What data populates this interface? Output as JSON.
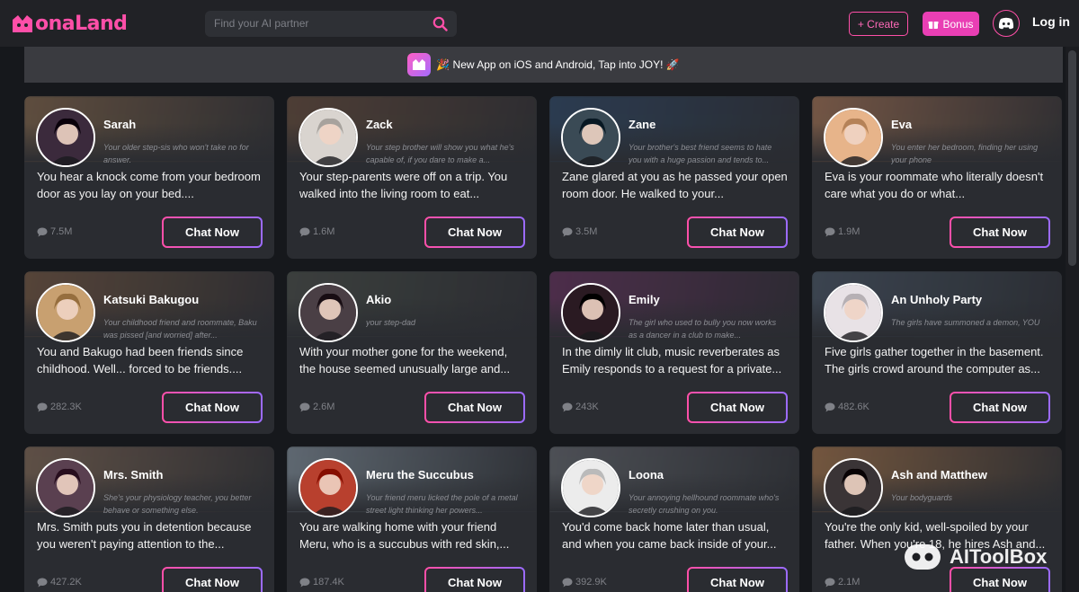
{
  "brand": {
    "logo_text": "onaLand",
    "colors": {
      "accent": "#ff4fa8",
      "accent2": "#9b6bff",
      "bg": "#16181c",
      "card": "#2a2c31"
    }
  },
  "search": {
    "placeholder": "Find your AI partner"
  },
  "header": {
    "create_label": "+ Create",
    "bonus_label": "Bonus",
    "login_label": "Log in"
  },
  "banner": {
    "text": "🎉 New App on iOS and Android, Tap into JOY! 🚀"
  },
  "chat_label": "Chat Now",
  "cards": [
    {
      "name": "Sarah",
      "tagline": "Your older step-sis who won't take no for answer.",
      "desc": "You hear a knock come from your bedroom door as you lay on your bed....",
      "count": "7.5M",
      "bg": "#8a6a4a",
      "av": "#3b2a3c"
    },
    {
      "name": "Zack",
      "tagline": "Your step brother will show you what he's capable of, if you dare to make a...",
      "desc": "Your step-parents were off on a trip. You walked into the living room to eat...",
      "count": "1.6M",
      "bg": "#6b4e3a",
      "av": "#d9d4cf"
    },
    {
      "name": "Zane",
      "tagline": "Your brother's best friend seems to hate you with a huge passion and tends to...",
      "desc": "Zane glared at you as he passed your open room door. He walked to your...",
      "count": "3.5M",
      "bg": "#2d4a6b",
      "av": "#3a4a55"
    },
    {
      "name": "Eva",
      "tagline": "You enter her bedroom, finding her using your phone",
      "desc": "Eva is your roommate who literally doesn't care what you do or what...",
      "count": "1.9M",
      "bg": "#b07a56",
      "av": "#e7b48a"
    },
    {
      "name": "Katsuki Bakugou",
      "tagline": "Your childhood friend and roommate, Baku was pissed [and worried] after...",
      "desc": "You and Bakugo had been friends since childhood. Well... forced to be friends....",
      "count": "282.3K",
      "bg": "#7a5a40",
      "av": "#c8a070"
    },
    {
      "name": "Akio",
      "tagline": "your step-dad",
      "desc": "With your mother gone for the weekend, the house seemed unusually large and...",
      "count": "2.6M",
      "bg": "#4a5048",
      "av": "#4a3f45"
    },
    {
      "name": "Emily",
      "tagline": "The girl who used to bully you now works as a dancer in a club to make...",
      "desc": "In the dimly lit club, music reverberates as Emily responds to a request for a private...",
      "count": "243K",
      "bg": "#6a3060",
      "av": "#2a1a22"
    },
    {
      "name": "An Unholy Party",
      "tagline": "The girls have summoned a demon, YOU",
      "desc": "Five girls gather together in the basement. The girls crowd around the computer as...",
      "count": "482.6K",
      "bg": "#4a5a6a",
      "av": "#e8e2e6"
    },
    {
      "name": "Mrs. Smith",
      "tagline": "She's your physiology teacher, you better behave or something else.",
      "desc": "Mrs. Smith puts you in detention because you weren't paying attention to the...",
      "count": "427.2K",
      "bg": "#8a6e58",
      "av": "#5a4050"
    },
    {
      "name": "Meru the Succubus",
      "tagline": "Your friend meru licked the pole of a metal street light thinking her powers...",
      "desc": "You are walking home with your friend Meru, who is a succubus with red skin,...",
      "count": "187.4K",
      "bg": "#8a9aa6",
      "av": "#b8402e"
    },
    {
      "name": "Loona",
      "tagline": "Your annoying hellhound roommate who's secretly crushing on you.",
      "desc": "You'd come back home later than usual, and when you came back inside of your...",
      "count": "392.9K",
      "bg": "#6a6e74",
      "av": "#ececec"
    },
    {
      "name": "Ash and Matthew",
      "tagline": "Your bodyguards",
      "desc": "You're the only kid, well-spoiled by your father. When you're 18, he hires Ash and...",
      "count": "2.1M",
      "bg": "#b07a4a",
      "av": "#3a3436"
    }
  ],
  "watermark": {
    "text": "AIToolBox"
  }
}
